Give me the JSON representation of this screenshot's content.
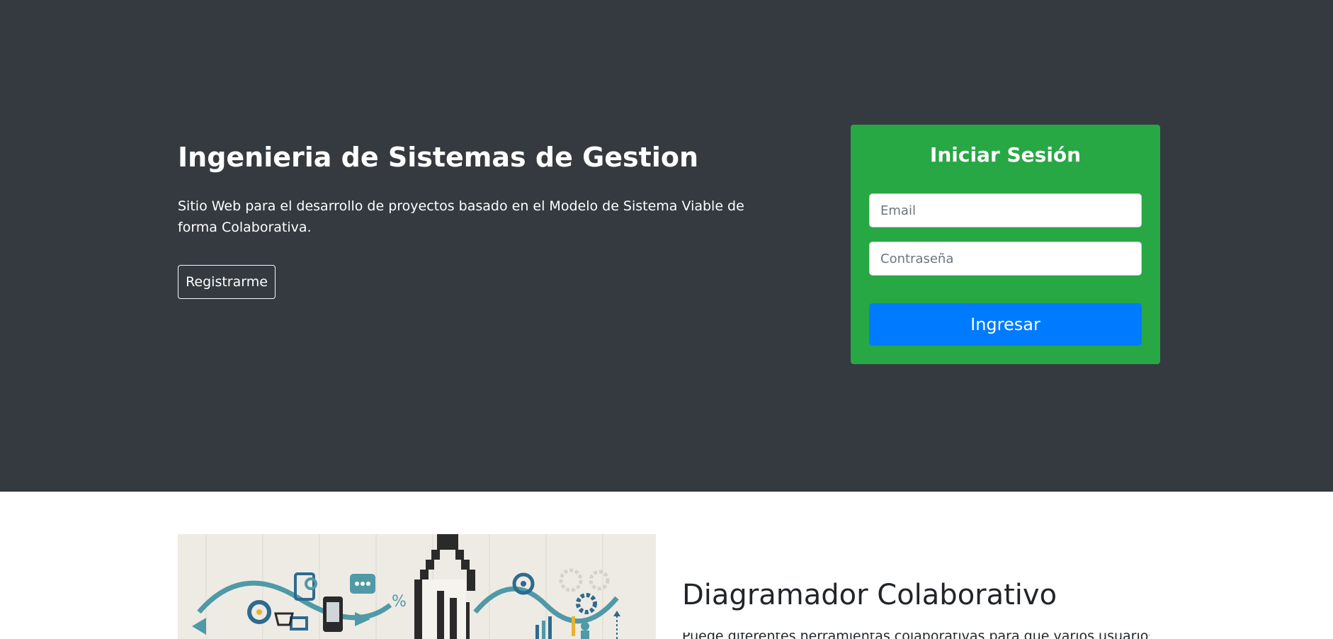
{
  "hero": {
    "title": "Ingenieria de Sistemas de Gestion",
    "description": "Sitio Web para el desarrollo de proyectos basado en el Modelo de Sistema Viable de forma Colaborativa.",
    "register_label": "Registrarme",
    "background_color": "#343a40"
  },
  "login": {
    "title": "Iniciar Sesión",
    "email_placeholder": "Email",
    "password_placeholder": "Contraseña",
    "submit_label": "Ingresar",
    "card_color": "#28a745",
    "button_color": "#007bff"
  },
  "feature": {
    "title": "Diagramador Colaborativo",
    "text": "Puede diferentes herramientas colaborativas para que varios usuarios trabajen"
  }
}
